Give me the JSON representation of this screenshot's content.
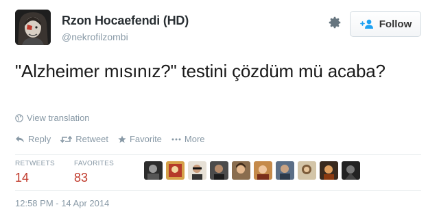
{
  "author": {
    "name": "Rzon Hocaefendi (HD)",
    "handle": "@nekrofilzombi"
  },
  "follow_button": {
    "label": "Follow"
  },
  "tweet": {
    "text": "\"Alzheimer mısınız?\" testini çözdüm mü acaba?"
  },
  "translation_link": "View translation",
  "actions": {
    "reply": "Reply",
    "retweet": "Retweet",
    "favorite": "Favorite",
    "more": "More"
  },
  "stats": {
    "retweets_label": "RETWEETS",
    "retweets_count": "14",
    "favorites_label": "FAVORITES",
    "favorites_count": "83"
  },
  "timestamp": "12:58 PM - 14 Apr 2014",
  "colors": {
    "accent": "#1da1f2",
    "count": "#c0392b",
    "muted": "#8899a6"
  },
  "icons": [
    "gear-icon",
    "follow-person-icon",
    "globe-icon",
    "reply-icon",
    "retweet-icon",
    "star-icon",
    "more-dots-icon"
  ]
}
